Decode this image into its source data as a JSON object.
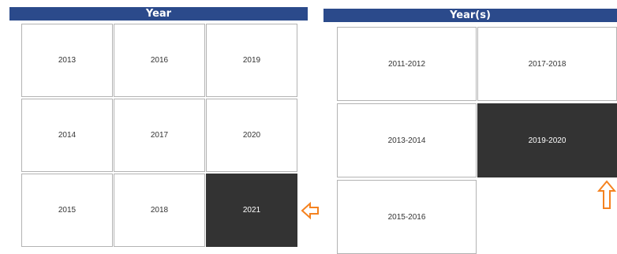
{
  "slicer_year": {
    "header": "Year",
    "tiles": [
      "2013",
      "2016",
      "2019",
      "2014",
      "2017",
      "2020",
      "2015",
      "2018",
      "2021"
    ],
    "selected": "2021"
  },
  "slicer_year_range": {
    "header": "Year(s)",
    "tiles": [
      "2011-2012",
      "2017-2018",
      "2013-2014",
      "2019-2020",
      "2015-2016"
    ],
    "selected": "2019-2020"
  },
  "annotations": {
    "arrow_color": "#f5821f",
    "icons": [
      "arrow-left-icon",
      "arrow-up-icon"
    ]
  },
  "colors": {
    "header_bg": "#2b4a8b",
    "selected_bg": "#333333",
    "tile_border": "#b3b3b3"
  }
}
